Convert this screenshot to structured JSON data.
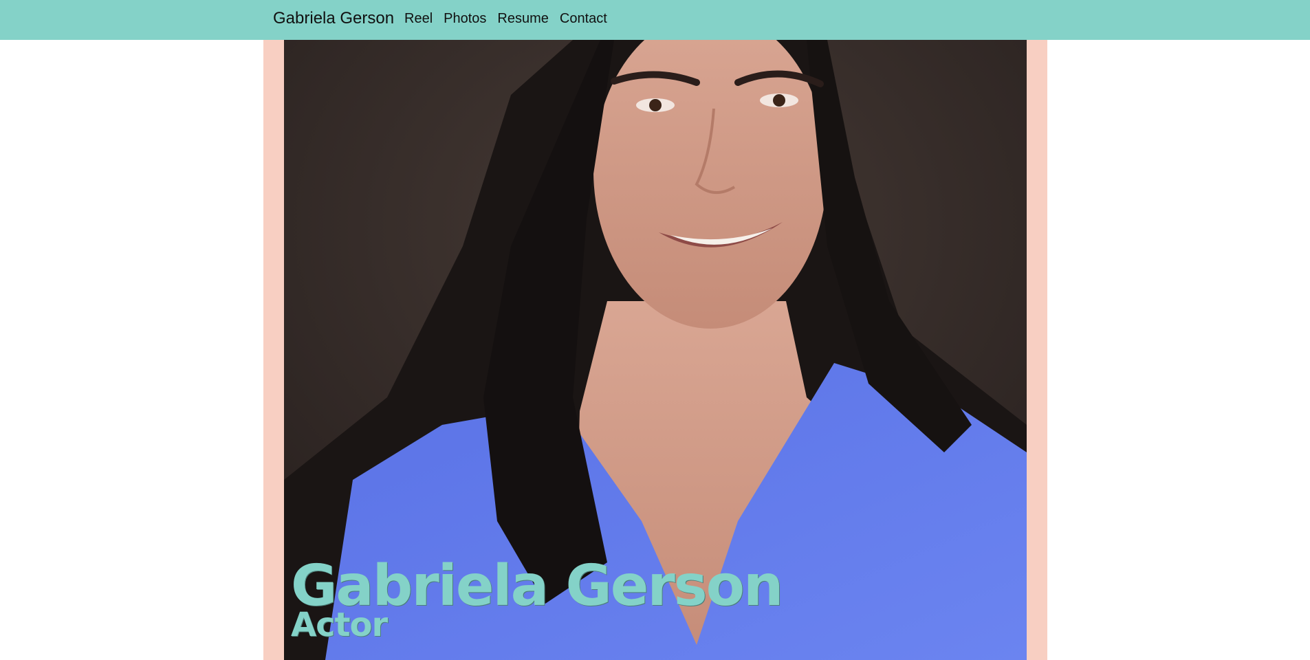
{
  "navbar": {
    "brand": "Gabriela Gerson",
    "links": [
      "Reel",
      "Photos",
      "Resume",
      "Contact"
    ]
  },
  "hero": {
    "name": "Gabriela Gerson",
    "role": "Actor"
  },
  "colors": {
    "navbar_bg": "#84d2c8",
    "frame_bg": "#f8cfc2",
    "accent_text": "#84d2c8",
    "shirt": "#5f78ec"
  }
}
